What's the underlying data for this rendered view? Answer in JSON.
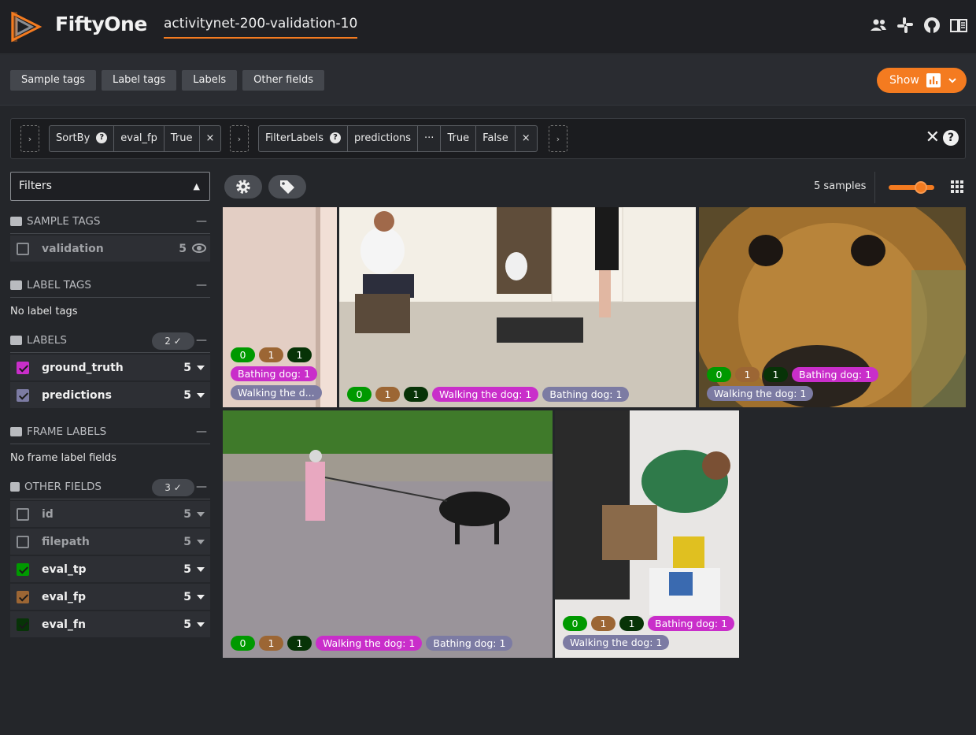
{
  "app": {
    "brand": "FiftyOne",
    "dataset_name": "activitynet-200-validation-10"
  },
  "header_icons": [
    "people-icon",
    "slack-icon",
    "github-icon",
    "docs-icon"
  ],
  "toolbar": {
    "tabs": [
      "Sample tags",
      "Label tags",
      "Labels",
      "Other fields"
    ],
    "show_label": "Show"
  },
  "view_bar": {
    "stage1": {
      "name": "SortBy",
      "field": "eval_fp",
      "value": "True",
      "help": "?"
    },
    "stage2": {
      "name": "FilterLabels",
      "field": "predictions",
      "expr": "···",
      "arg1": "True",
      "arg2": "False",
      "help": "?"
    },
    "add_symbol": "›",
    "remove_symbol": "×",
    "close_symbol": "✕",
    "help_symbol": "?"
  },
  "sidebar": {
    "filters_label": "Filters",
    "sections": {
      "sample_tags": {
        "title": "SAMPLE TAGS",
        "items": [
          {
            "label": "validation",
            "count": "5"
          }
        ]
      },
      "label_tags": {
        "title": "LABEL TAGS",
        "empty": "No label tags"
      },
      "labels": {
        "title": "LABELS",
        "badge": "2 ✓",
        "items": [
          {
            "label": "ground_truth",
            "count": "5",
            "color": "#c92eca"
          },
          {
            "label": "predictions",
            "count": "5",
            "color": "#7c7ba3"
          }
        ]
      },
      "frame_labels": {
        "title": "FRAME LABELS",
        "empty": "No frame label fields"
      },
      "other_fields": {
        "title": "OTHER FIELDS",
        "badge": "3 ✓",
        "items": [
          {
            "label": "id",
            "count": "5"
          },
          {
            "label": "filepath",
            "count": "5"
          },
          {
            "label": "eval_tp",
            "count": "5",
            "color": "#009900"
          },
          {
            "label": "eval_fp",
            "count": "5",
            "color": "#9c6634"
          },
          {
            "label": "eval_fn",
            "count": "5",
            "color": "#073307"
          }
        ]
      }
    },
    "collapse_symbol": "—"
  },
  "grid": {
    "samples_label": "5 samples",
    "tiles": [
      {
        "tp": "0",
        "fp": "1",
        "fn": "1",
        "gt": "Bathing dog: 1",
        "pred": "Walking the d..."
      },
      {
        "tp": "0",
        "fp": "1",
        "fn": "1",
        "gt": "Walking the dog: 1",
        "pred": "Bathing dog: 1"
      },
      {
        "tp": "0",
        "fp": "1",
        "fn": "1",
        "gt": "Bathing dog: 1",
        "pred": "Walking the dog: 1"
      },
      {
        "tp": "0",
        "fp": "1",
        "fn": "1",
        "gt": "Walking the dog: 1",
        "pred": "Bathing dog: 1"
      },
      {
        "tp": "0",
        "fp": "1",
        "fn": "1",
        "gt": "Bathing dog: 1",
        "pred": "Walking the dog: 1"
      }
    ]
  },
  "colors": {
    "accent": "#f47b20",
    "tp": "#009900",
    "fp": "#9c6634",
    "fn": "#073307",
    "ground_truth": "#c92eca",
    "predictions": "#7c7ba3"
  }
}
